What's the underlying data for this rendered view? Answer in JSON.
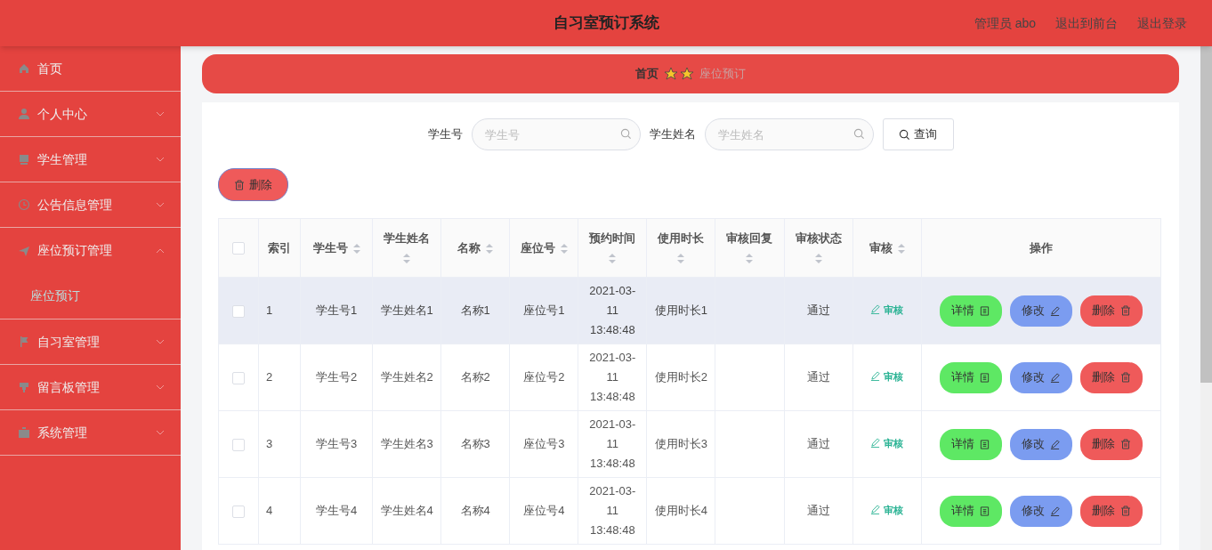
{
  "header": {
    "title": "自习室预订系统",
    "links": [
      "管理员 abo",
      "退出到前台",
      "退出登录"
    ]
  },
  "sidebar": {
    "items": [
      {
        "label": "首页",
        "kind": "link"
      },
      {
        "label": "个人中心",
        "kind": "group",
        "expanded": false
      },
      {
        "label": "学生管理",
        "kind": "group",
        "expanded": false
      },
      {
        "label": "公告信息管理",
        "kind": "group",
        "expanded": false
      },
      {
        "label": "座位预订管理",
        "kind": "group",
        "expanded": true,
        "children": [
          {
            "label": "座位预订",
            "selected": true
          }
        ]
      },
      {
        "label": "自习室管理",
        "kind": "group",
        "expanded": false
      },
      {
        "label": "留言板管理",
        "kind": "group",
        "expanded": false
      },
      {
        "label": "系统管理",
        "kind": "group",
        "expanded": false
      }
    ]
  },
  "breadcrumb": [
    "首页",
    "座位预订"
  ],
  "search": {
    "fields": [
      {
        "label": "学生号",
        "placeholder": "学生号"
      },
      {
        "label": "学生姓名",
        "placeholder": "学生姓名"
      }
    ],
    "button": "查询"
  },
  "delete_button": "删除",
  "table": {
    "all_checked": false,
    "columns": [
      {
        "label": "索引",
        "sortable": false
      },
      {
        "label": "学生号",
        "sortable": true
      },
      {
        "label": "学生姓名",
        "sortable": true
      },
      {
        "label": "名称",
        "sortable": true
      },
      {
        "label": "座位号",
        "sortable": true
      },
      {
        "label": "预约时间",
        "sortable": true
      },
      {
        "label": "使用时长",
        "sortable": true
      },
      {
        "label": "审核回复",
        "sortable": true
      },
      {
        "label": "审核状态",
        "sortable": true
      },
      {
        "label": "审核",
        "sortable": true
      },
      {
        "label": "操作",
        "sortable": false
      }
    ],
    "rows": [
      {
        "checked": false,
        "highlighted": true,
        "cells": [
          "1",
          "学生号1",
          "学生姓名1",
          "名称1",
          "座位号1",
          "2021-03-11 13:48:48",
          "使用时长1",
          "",
          "通过"
        ],
        "review": "审核",
        "actions": [
          "详情",
          "修改",
          "删除"
        ]
      },
      {
        "checked": false,
        "highlighted": false,
        "cells": [
          "2",
          "学生号2",
          "学生姓名2",
          "名称2",
          "座位号2",
          "2021-03-11 13:48:48",
          "使用时长2",
          "",
          "通过"
        ],
        "review": "审核",
        "actions": [
          "详情",
          "修改",
          "删除"
        ]
      },
      {
        "checked": false,
        "highlighted": false,
        "cells": [
          "3",
          "学生号3",
          "学生姓名3",
          "名称3",
          "座位号3",
          "2021-03-11 13:48:48",
          "使用时长3",
          "",
          "通过"
        ],
        "review": "审核",
        "actions": [
          "详情",
          "修改",
          "删除"
        ]
      },
      {
        "checked": false,
        "highlighted": false,
        "cells": [
          "4",
          "学生号4",
          "学生姓名4",
          "名称4",
          "座位号4",
          "2021-03-11 13:48:48",
          "使用时长4",
          "",
          "通过"
        ],
        "review": "审核",
        "actions": [
          "详情",
          "修改",
          "删除"
        ]
      }
    ]
  }
}
